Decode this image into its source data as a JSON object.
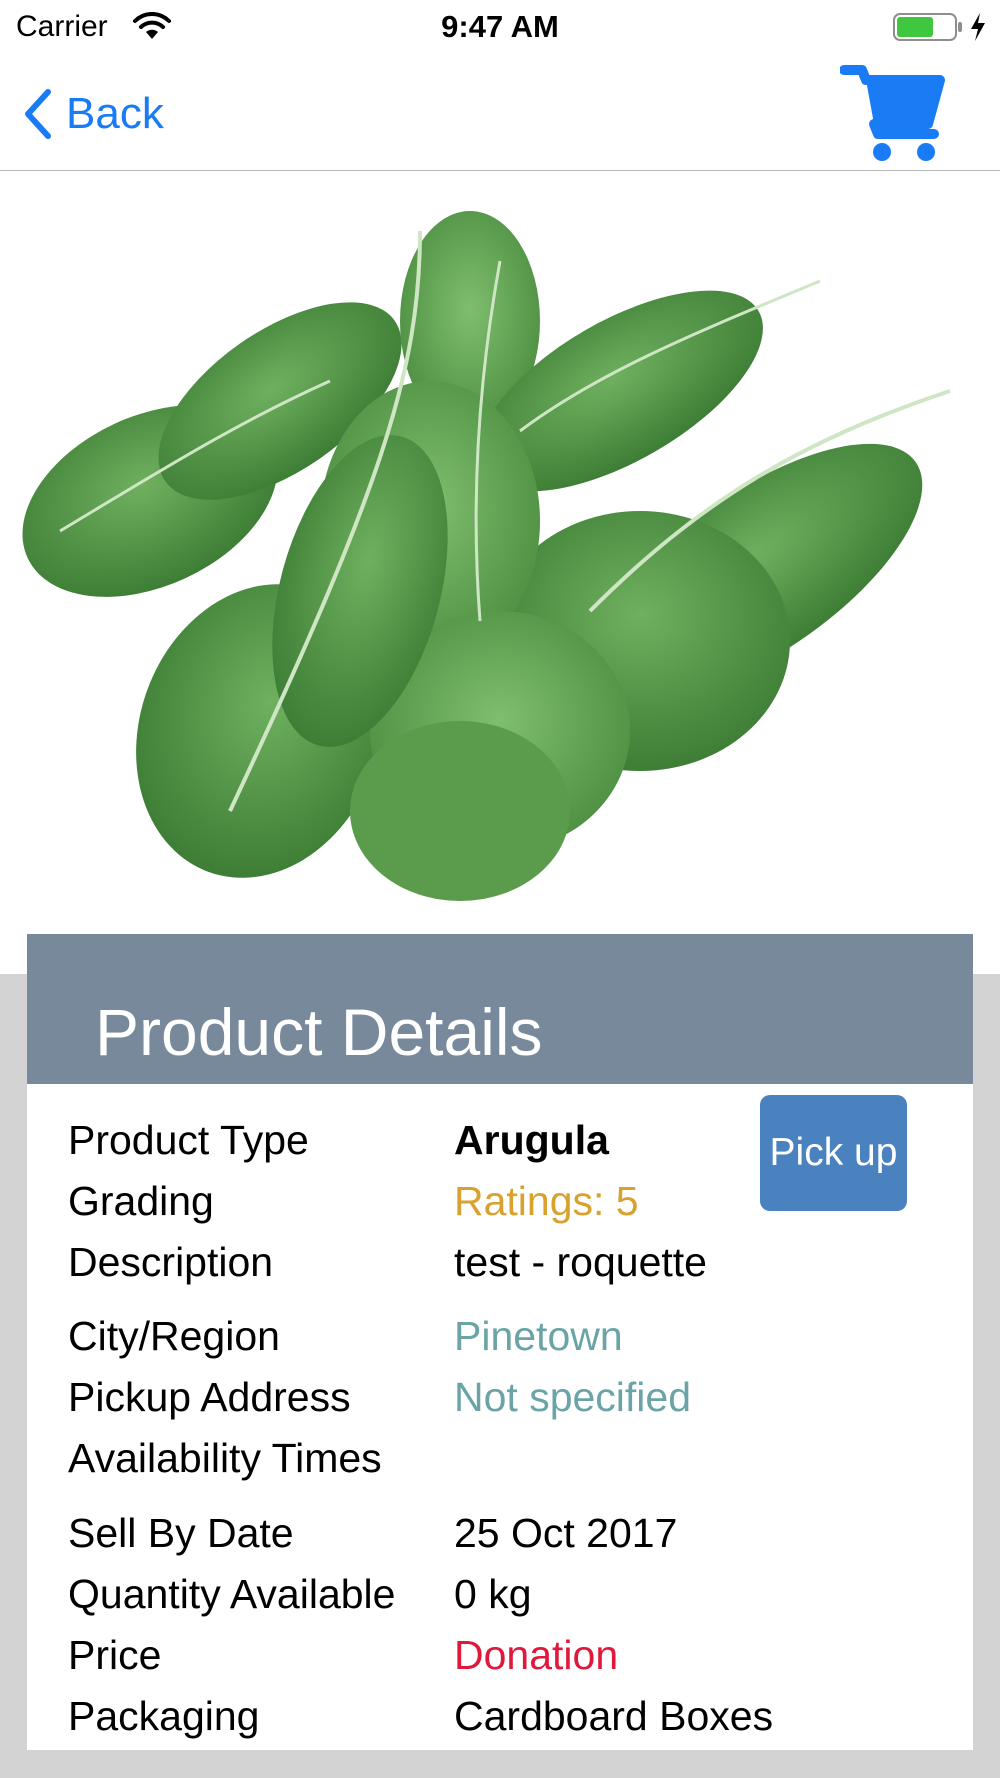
{
  "status_bar": {
    "carrier": "Carrier",
    "time": "9:47 AM",
    "icons": [
      "wifi-icon",
      "battery-icon",
      "charging-bolt-icon"
    ],
    "battery_color": "#3fc83f"
  },
  "nav": {
    "back_label": "Back",
    "cart_icon": "shopping-cart-icon",
    "accent": "#1a7cf5"
  },
  "hero": {
    "image": "arugula-leaves"
  },
  "details": {
    "title": "Product Details",
    "pickup_label": "Pick up",
    "rows": [
      {
        "label": "Product Type",
        "value": "Arugula"
      },
      {
        "label": "Grading",
        "value": "Ratings: 5"
      },
      {
        "label": "Description",
        "value": "test - roquette"
      },
      {
        "label": "City/Region",
        "value": "Pinetown"
      },
      {
        "label": "Pickup Address",
        "value": "Not specified"
      },
      {
        "label": "Availability Times",
        "value": ""
      },
      {
        "label": "Sell By Date",
        "value": "25 Oct 2017"
      },
      {
        "label": "Quantity Available",
        "value": "0 kg"
      },
      {
        "label": "Price",
        "value": "Donation"
      },
      {
        "label": "Packaging",
        "value": "Cardboard Boxes"
      }
    ],
    "colors": {
      "header_bg": "#77899b",
      "rating": "#d9a12e",
      "location": "#6aa4a6",
      "price": "#e0193c",
      "button": "#4a82bf"
    }
  }
}
